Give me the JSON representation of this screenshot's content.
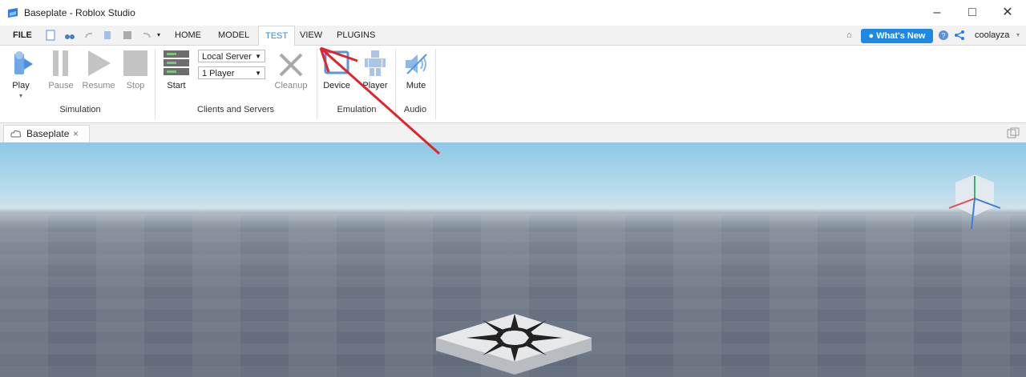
{
  "window": {
    "title": "Baseplate - Roblox Studio",
    "minimize": "–",
    "maximize": "□",
    "close": "✕"
  },
  "menu": {
    "file": "FILE",
    "tabs": [
      "HOME",
      "MODEL",
      "TEST",
      "VIEW",
      "PLUGINS"
    ],
    "active_tab": "TEST",
    "whats_new": "● What's New",
    "username": "coolayza"
  },
  "ribbon": {
    "simulation": {
      "play": "Play",
      "pause": "Pause",
      "resume": "Resume",
      "stop": "Stop",
      "label": "Simulation"
    },
    "clients": {
      "start": "Start",
      "server_select": "Local Server",
      "players_select": "1 Player",
      "cleanup": "Cleanup",
      "label": "Clients and Servers"
    },
    "emulation": {
      "device": "Device",
      "player": "Player",
      "label": "Emulation"
    },
    "audio": {
      "mute": "Mute",
      "label": "Audio"
    }
  },
  "document_tab": {
    "label": "Baseplate",
    "close": "×"
  },
  "colors": {
    "accent": "#2a8de0",
    "whats_new_bg": "#1e88e5",
    "annotation_arrow": "#e0252b"
  }
}
